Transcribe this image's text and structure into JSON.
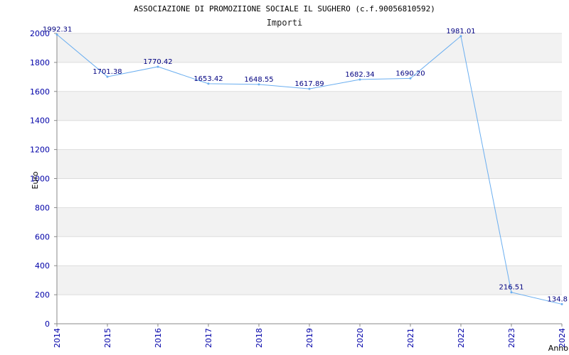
{
  "chart_data": {
    "type": "line",
    "title": "ASSOCIAZIONE DI PROMOZIIONE SOCIALE IL SUGHERO (c.f.90056810592)",
    "subtitle": "Importi",
    "xlabel": "Anno",
    "ylabel": "Euro",
    "categories": [
      "2014",
      "2015",
      "2016",
      "2017",
      "2018",
      "2019",
      "2020",
      "2021",
      "2022",
      "2023",
      "2024"
    ],
    "series": [
      {
        "values": [
          1992.31,
          1701.38,
          1770.42,
          1653.42,
          1648.55,
          1617.89,
          1682.34,
          1690.2,
          1981.01,
          216.51,
          134.8
        ],
        "labels": [
          "1992.31",
          "1701.38",
          "1770.42",
          "1653.42",
          "1648.55",
          "1617.89",
          "1682.34",
          "1690.20",
          "1981.01",
          "216.51",
          "134.8"
        ],
        "color": "#6aaef0"
      }
    ],
    "ylim": [
      0,
      2000
    ],
    "yticks": [
      "0",
      "200",
      "400",
      "600",
      "800",
      "1000",
      "1200",
      "1400",
      "1600",
      "1800",
      "2000"
    ],
    "grid": true,
    "band_colors": [
      "#ffffff",
      "#f2f2f2"
    ],
    "tick_color": "#0000a8",
    "label_color": "#000080"
  }
}
